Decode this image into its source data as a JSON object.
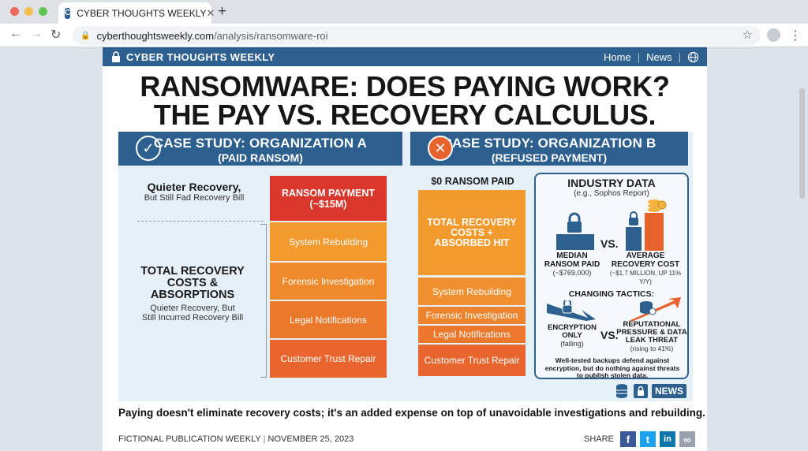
{
  "browser": {
    "tab_title": "CYBER THOUGHTS WEEKLY",
    "favicon_letter": "C",
    "url_domain": "cyberthoughtsweekly.com",
    "url_path": "/analysis/ransomware-roi"
  },
  "site": {
    "name": "CYBER THOUGHTS WEEKLY",
    "nav": [
      "Home",
      "News"
    ]
  },
  "headline": [
    "RANSOMWARE: DOES PAYING WORK?",
    "THE PAY VS. RECOVERY CALCULUS."
  ],
  "org_a": {
    "title": "CASE STUDY: ORGANIZATION A",
    "subtitle": "(PAID RANSOM)",
    "quiet_title": "Quieter Recovery,",
    "quiet_sub": "But Still Fad Recovery Bill",
    "total_title": [
      "TOTAL RECOVERY",
      "COSTS &",
      "ABSORPTIONS"
    ],
    "total_sub": [
      "Quieter Recovery, But",
      "Still Incurred Recovery Bill"
    ],
    "ransom_block": [
      "RANSOM PAYMENT",
      "(~$15M)"
    ],
    "blocks": [
      "System Rebuilding",
      "Forensic Investigation",
      "Legal Notifications",
      "Customer Trust Repair"
    ]
  },
  "org_b": {
    "title": "CASE STUDY: ORGANIZATION B",
    "subtitle": "(REFUSED PAYMENT)",
    "zero_paid": "$0 RANSOM PAID",
    "total_block": [
      "TOTAL RECOVERY",
      "COSTS +",
      "ABSORBED HIT"
    ],
    "blocks": [
      "System Rebuilding",
      "Forensic Investigation",
      "Legal Notifications",
      "Customer Trust Repair"
    ]
  },
  "industry": {
    "title": "INDUSTRY DATA",
    "subtitle": "(e.g., Sophos Report)",
    "vs": "VS.",
    "median_label": [
      "MEDIAN",
      "RANSOM PAID"
    ],
    "median_value": "(~$769,000)",
    "average_label": [
      "AVERAGE",
      "RECOVERY COST"
    ],
    "average_value": "(~$1.7 MILLION, UP 11% Y/Y)",
    "tactics_title": "CHANGING TACTICS:",
    "encryption_label": [
      "ENCRYPTION",
      "ONLY"
    ],
    "encryption_sub": "(falling)",
    "reputation_label": [
      "REPUTATIONAL",
      "PRESSURE & DATA",
      "LEAK THREAT"
    ],
    "reputation_sub": "(rising to 41%)",
    "note": [
      "Well-tested backups defend against",
      "encryption, but do nothing against threats",
      "to publish stolen data."
    ]
  },
  "badge": "NEWS",
  "footer_text": "Paying doesn't eliminate recovery costs; it's an added expense on top of unavoidable investigations and rebuilding.",
  "byline": {
    "publication": "FICTIONAL PUBLICATION WEEKLY",
    "date": "NOVEMBER 25, 2023"
  },
  "share": {
    "label": "SHARE",
    "icons": [
      "f",
      "t",
      "in",
      "∞"
    ]
  },
  "colors": {
    "brand_blue": "#2d5f8f",
    "red": "#d9372c",
    "orange": "#f39a2e",
    "orange_deep": "#e8622d"
  }
}
